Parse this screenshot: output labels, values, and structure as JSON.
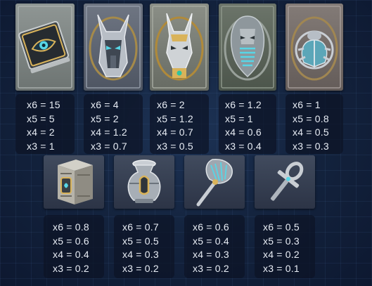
{
  "colors": {
    "background": "#14243f",
    "text": "#e8edf5",
    "gold": "#d9b35a",
    "teal": "#57d6e6"
  },
  "symbols": [
    {
      "icon": "eye-book-icon",
      "pays": [
        "x6 = 15",
        "x5 = 5",
        "x4 = 2",
        "x3 = 1"
      ]
    },
    {
      "icon": "anubis-helmet-icon",
      "pays": [
        "x6 = 4",
        "x5 = 2",
        "x4 = 1.2",
        "x3 = 0.7"
      ]
    },
    {
      "icon": "anubis-head-icon",
      "pays": [
        "x6 = 2",
        "x5 = 1.2",
        "x4 = 0.7",
        "x3 = 0.5"
      ]
    },
    {
      "icon": "pharaoh-mask-icon",
      "pays": [
        "x6 = 1.2",
        "x5 = 1",
        "x4 = 0.6",
        "x3 = 0.4"
      ]
    },
    {
      "icon": "scarab-icon",
      "pays": [
        "x6 = 1",
        "x5 = 0.8",
        "x4 = 0.5",
        "x3 = 0.3"
      ]
    },
    {
      "icon": "stone-cube-icon",
      "pays": [
        "x6 = 0.8",
        "x5 = 0.6",
        "x4 = 0.4",
        "x3 = 0.2"
      ]
    },
    {
      "icon": "vase-icon",
      "pays": [
        "x6 = 0.7",
        "x5 = 0.5",
        "x4 = 0.3",
        "x3 = 0.2"
      ]
    },
    {
      "icon": "fan-icon",
      "pays": [
        "x6 = 0.6",
        "x5 = 0.4",
        "x4 = 0.3",
        "x3 = 0.2"
      ]
    },
    {
      "icon": "ankh-icon",
      "pays": [
        "x6 = 0.5",
        "x5 = 0.3",
        "x4 = 0.2",
        "x3 = 0.1"
      ]
    }
  ]
}
